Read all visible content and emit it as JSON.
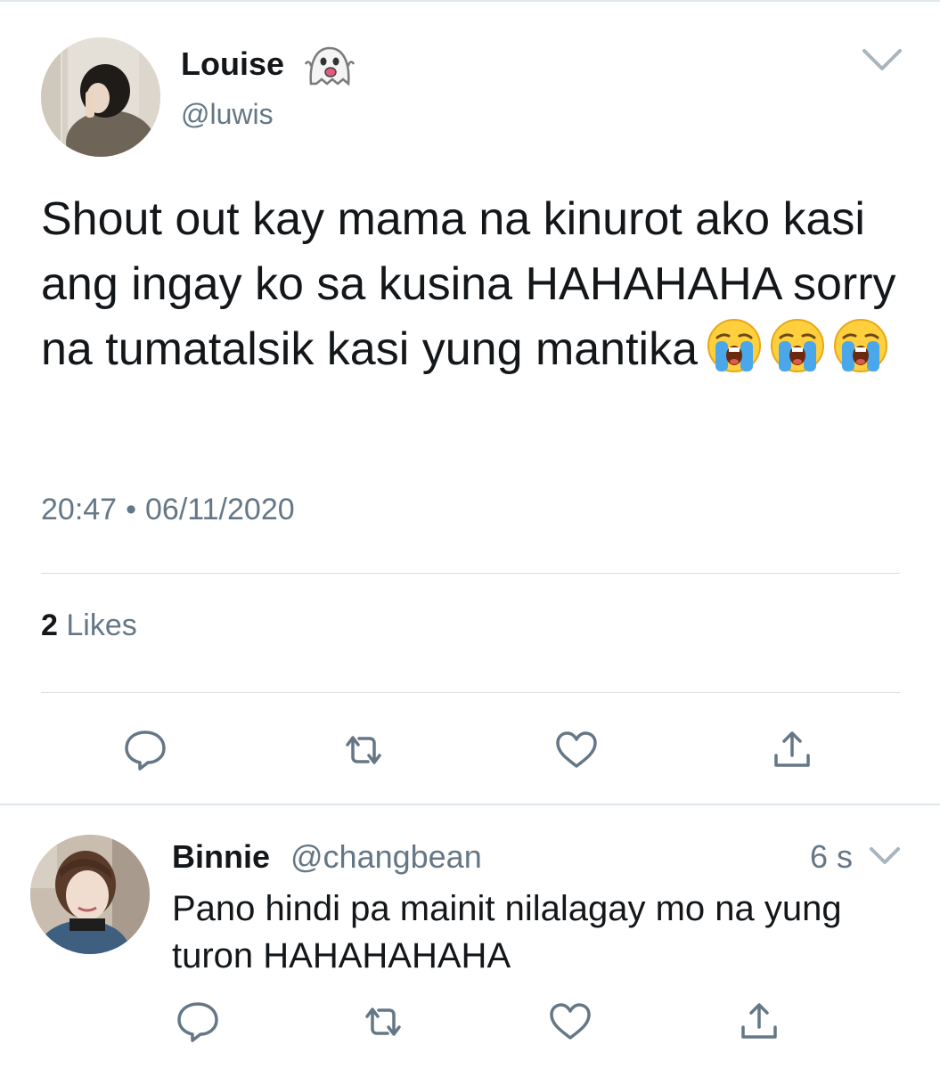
{
  "tweet": {
    "author": {
      "name": "Louise",
      "handle": "@luwis",
      "name_emoji_icon": "ghost-emoji-icon"
    },
    "text": "Shout out kay mama na kinurot ako kasi ang ingay ko sa kusina HAHAHAHA sorry na tumatalsik kasi yung mantika",
    "trailing_emoji": [
      "loudly-crying-face-emoji",
      "loudly-crying-face-emoji",
      "loudly-crying-face-emoji"
    ],
    "time": "20:47",
    "separator": "•",
    "date": "06/11/2020",
    "likes": {
      "count": "2",
      "label": "Likes"
    },
    "actions": [
      "reply-icon",
      "retweet-icon",
      "like-icon",
      "share-icon"
    ]
  },
  "reply": {
    "author": {
      "name": "Binnie",
      "handle": "@changbean"
    },
    "time": "6 s",
    "text": "Pano hindi pa mainit nilalagay mo na yung turon HAHAHAHAHA",
    "actions": [
      "reply-icon",
      "retweet-icon",
      "like-icon",
      "share-icon"
    ]
  },
  "colors": {
    "text": "#14171a",
    "secondary": "#657786",
    "icon": "#657786",
    "divider": "#e1e8ed"
  }
}
